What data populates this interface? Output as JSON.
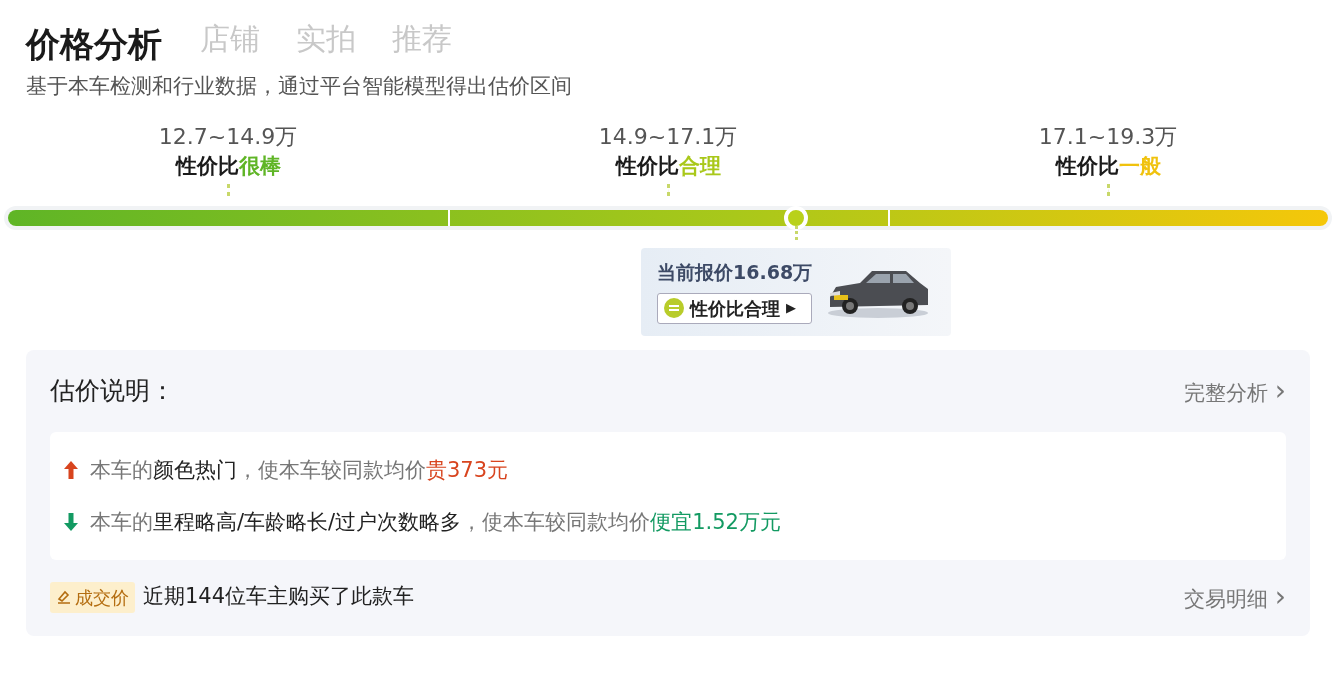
{
  "tabs": [
    {
      "label": "店铺"
    },
    {
      "label": "实拍"
    },
    {
      "label": "推荐"
    }
  ],
  "title": "价格分析",
  "subtitle": "基于本车检测和行业数据，通过平台智能模型得出估价区间",
  "ranges": [
    {
      "price": "12.7~14.9万",
      "prefix": "性价比",
      "rating": "很棒",
      "color": "#5fb526"
    },
    {
      "price": "14.9~17.1万",
      "prefix": "性价比",
      "rating": "合理",
      "color": "#a9c81a"
    },
    {
      "price": "17.1~19.3万",
      "prefix": "性价比",
      "rating": "一般",
      "color": "#f0c20d"
    }
  ],
  "meter": {
    "level": 0.597
  },
  "current": {
    "label": "当前报价16.68万",
    "badge": "性价比合理",
    "badge_arrow": "▶"
  },
  "explanation": {
    "title": "估价说明：",
    "link": "完整分析",
    "link_arrow": "›",
    "items": [
      {
        "kind": "up",
        "prefix": "本车的",
        "factor": "颜色热门",
        "middle": "，使本车较同款均价",
        "result": "贵373元"
      },
      {
        "kind": "down",
        "prefix": "本车的",
        "factor": "里程略高/车龄略长/过户次数略多",
        "middle": "，使本车较同款均价",
        "result": "便宜1.52万元"
      }
    ],
    "deal_tag": "成交价",
    "deal_text": "近期144位车主购买了此款车",
    "deal_link": "交易明细",
    "deal_arrow": "›"
  }
}
